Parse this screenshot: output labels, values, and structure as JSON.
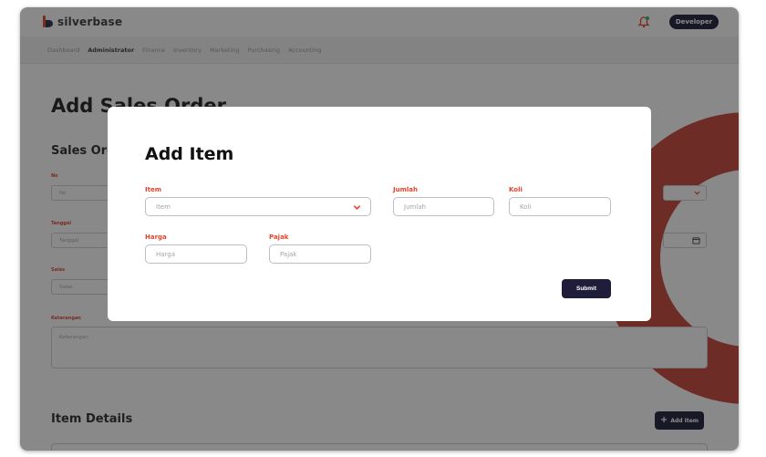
{
  "app": {
    "brand": "silverbase",
    "role_badge": "Developer",
    "brand_color": "#e2452b",
    "dark_color": "#1f1d3a"
  },
  "nav": {
    "items": [
      {
        "label": "Dashboard"
      },
      {
        "label": "Administrator"
      },
      {
        "label": "Finance"
      },
      {
        "label": "Inventory"
      },
      {
        "label": "Marketing"
      },
      {
        "label": "Purchasing"
      },
      {
        "label": "Accounting"
      }
    ],
    "active": "Administrator"
  },
  "page": {
    "title": "Add Sales Order",
    "section_title": "Sales Order",
    "fields": {
      "no_label": "No",
      "no_placeholder": "No",
      "tanggal_label": "Tanggal",
      "tanggal_placeholder": "Tanggal",
      "sales_label": "Sales",
      "sales_placeholder": "Sales",
      "keterangan_label": "Keterangan",
      "keterangan_placeholder": "Keterangan"
    },
    "item_details_title": "Item Details",
    "add_item_label": "Add Item"
  },
  "modal": {
    "title": "Add Item",
    "item_label": "Item",
    "item_placeholder": "Item",
    "jumlah_label": "Jumlah",
    "jumlah_placeholder": "Jumlah",
    "koli_label": "Koli",
    "koli_placeholder": "Koli",
    "harga_label": "Harga",
    "harga_placeholder": "Harga",
    "pajak_label": "Pajak",
    "pajak_placeholder": "Pajak",
    "submit_label": "Submit"
  },
  "icons": {
    "logo": "silverbase-logo-icon",
    "notification": "bell-icon",
    "dropdown": "chevron-down-icon",
    "calendar": "calendar-icon",
    "add": "plus-icon"
  }
}
